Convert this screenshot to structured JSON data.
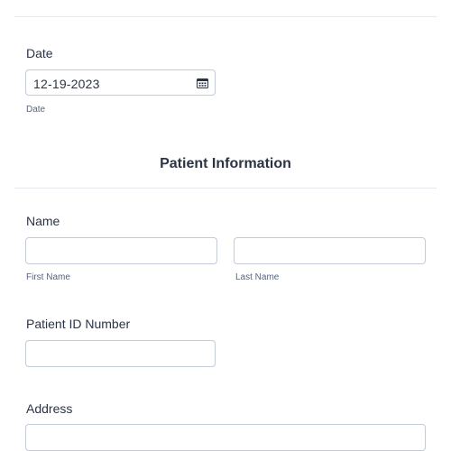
{
  "date_field": {
    "label": "Date",
    "value": "12-19-2023",
    "sublabel": "Date",
    "icon": "calendar-icon"
  },
  "section": {
    "heading": "Patient Information"
  },
  "name_field": {
    "label": "Name",
    "first_value": "",
    "last_value": "",
    "first_sublabel": "First Name",
    "last_sublabel": "Last Name"
  },
  "patient_id_field": {
    "label": "Patient ID Number",
    "value": ""
  },
  "address_field": {
    "label": "Address",
    "value": ""
  }
}
